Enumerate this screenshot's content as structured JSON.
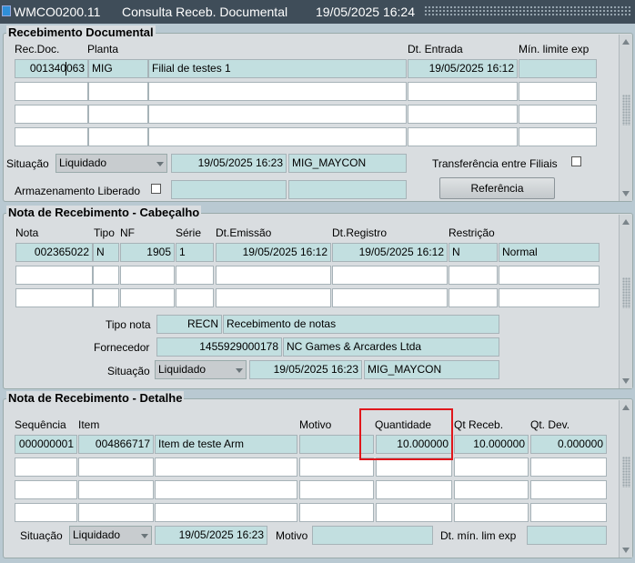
{
  "window": {
    "code": "WMCO0200.11",
    "name": "Consulta Receb. Documental",
    "datetime": "19/05/2025 16:24"
  },
  "p1": {
    "title": "Recebimento Documental",
    "headers": {
      "rec_doc": "Rec.Doc.",
      "planta": "Planta",
      "dt_entrada": "Dt. Entrada",
      "min_limite": "Mín. limite exp"
    },
    "row": {
      "rec_doc": "001340063",
      "planta": "MIG",
      "planta_desc": "Filial de testes 1",
      "dt_entrada": "19/05/2025 16:12",
      "min_limite": ""
    },
    "situacao_label": "Situação",
    "situacao": "Liquidado",
    "situacao_data": "19/05/2025 16:23",
    "situacao_user": "MIG_MAYCON",
    "transferencia_label": "Transferência entre Filiais",
    "armazenamento_label": "Armazenamento Liberado",
    "referencia_button": "Referência"
  },
  "p2": {
    "title": "Nota de Recebimento - Cabeçalho",
    "headers": {
      "nota": "Nota",
      "tipo": "Tipo",
      "nf": "NF",
      "serie": "Série",
      "dt_emissao": "Dt.Emissão",
      "dt_registro": "Dt.Registro",
      "restricao": "Restrição"
    },
    "row": {
      "nota": "002365022",
      "tipo": "N",
      "nf": "1905",
      "serie": "1",
      "dt_emissao": "19/05/2025 16:12",
      "dt_registro": "19/05/2025 16:12",
      "restricao": "N",
      "restricao_desc": "Normal"
    },
    "tipo_nota_label": "Tipo nota",
    "tipo_nota": "RECN",
    "tipo_nota_desc": "Recebimento de notas",
    "fornecedor_label": "Fornecedor",
    "fornecedor": "1455929000178",
    "fornecedor_nome": "NC Games & Arcardes Ltda",
    "situacao_label": "Situação",
    "situacao": "Liquidado",
    "situacao_data": "19/05/2025 16:23",
    "situacao_user": "MIG_MAYCON"
  },
  "p3": {
    "title": "Nota de Recebimento - Detalhe",
    "headers": {
      "sequencia": "Sequência",
      "item": "Item",
      "motivo": "Motivo",
      "quantidade": "Quantidade",
      "qt_receb": "Qt  Receb.",
      "qt_dev": "Qt. Dev."
    },
    "row": {
      "sequencia": "000000001",
      "item": "004866717",
      "item_desc": "Item de teste Arm",
      "motivo": "",
      "quantidade": "10.000000",
      "qt_receb": "10.000000",
      "qt_dev": "0.000000"
    },
    "situacao_label": "Situação",
    "situacao": "Liquidado",
    "situacao_data": "19/05/2025 16:23",
    "motivo_label": "Motivo",
    "dt_min_label": "Dt. mín. lim exp"
  },
  "colors": {
    "titlebar": "#3f4d59",
    "readonly_field": "#c2dfe0",
    "panel": "#d9dde0",
    "highlight": "#e0161b"
  }
}
